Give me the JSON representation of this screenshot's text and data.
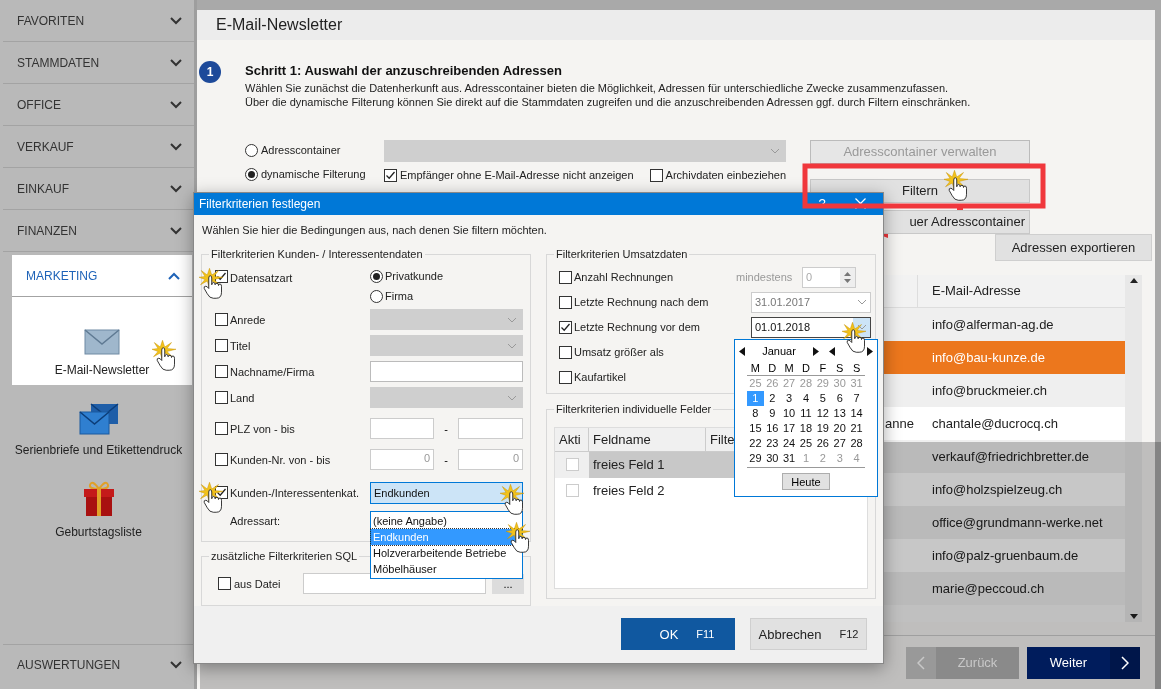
{
  "sidebar": {
    "sections": [
      {
        "label": "FAVORITEN",
        "expanded": false
      },
      {
        "label": "STAMMDATEN",
        "expanded": false
      },
      {
        "label": "OFFICE",
        "expanded": false
      },
      {
        "label": "VERKAUF",
        "expanded": false
      },
      {
        "label": "EINKAUF",
        "expanded": false
      },
      {
        "label": "FINANZEN",
        "expanded": false
      },
      {
        "label": "MARKETING",
        "expanded": true,
        "items": [
          {
            "label": "E-Mail-Newsletter",
            "kind": "envelope",
            "selected": true
          },
          {
            "label": "Serienbriefe und Etikettendruck",
            "kind": "envelopes",
            "selected": false
          },
          {
            "label": "Geburtstagsliste",
            "kind": "gift",
            "selected": false
          }
        ]
      }
    ],
    "bottom_section": {
      "label": "AUSWERTUNGEN",
      "expanded": false
    }
  },
  "page": {
    "title": "E-Mail-Newsletter",
    "step": {
      "number": "1",
      "title": "Schritt 1: Auswahl der anzuschreibenden Adressen",
      "description": [
        "Wählen Sie zunächst die Datenherkunft aus. Adresscontainer bieten die Möglichkeit, Adressen für unterschiedliche Zwecke zusammenzufassen.",
        "Über die dynamische Filterung können Sie direkt auf die Stammdaten zugreifen und die anzuschreibenden Adressen ggf. durch Filtern einschränken."
      ]
    },
    "source_options": [
      {
        "label": "Adresscontainer",
        "selected": false
      },
      {
        "label": "dynamische Filterung",
        "selected": true
      }
    ],
    "container_select": {
      "disabled": true
    },
    "options": [
      {
        "label": "Empfänger ohne E-Mail-Adresse nicht anzeigen",
        "checked": true
      },
      {
        "label": "Archivdaten einbeziehen",
        "checked": false
      }
    ],
    "buttons": [
      {
        "label": "Adresscontainer verwalten",
        "disabled": true
      },
      {
        "label": "Filtern",
        "disabled": false
      },
      {
        "label": "uer Adresscontainer",
        "disabled": false
      }
    ],
    "export_button": "Adressen exportieren",
    "table": {
      "columns": [
        "E-Mail-Adresse"
      ],
      "rows": [
        {
          "email": "info@alferman-ag.de",
          "selected": false
        },
        {
          "email": "info@bau-kunze.de",
          "selected": true
        },
        {
          "email": "info@bruckmeier.ch",
          "selected": false
        },
        {
          "column_1": "anne",
          "email": "chantale@ducrocq.ch",
          "selected": false
        },
        {
          "email": "verkauf@friedrichbretter.de",
          "selected": false
        },
        {
          "email": "info@holzspielzeug.ch",
          "selected": false
        },
        {
          "email": "office@grundmann-werke.net",
          "selected": false
        },
        {
          "email": "info@palz-gruenbaum.de",
          "selected": false
        },
        {
          "email": "marie@peccoud.ch",
          "selected": false
        }
      ]
    },
    "navigation": [
      {
        "label": "Zurück",
        "kind": "back",
        "disabled": true
      },
      {
        "label": "Weiter",
        "kind": "next",
        "disabled": false
      }
    ]
  },
  "dialog": {
    "title": "Filterkriterien festlegen",
    "help": "?",
    "instruction": "Wählen Sie hier die Bedingungen aus, nach denen Sie filtern möchten.",
    "customer_group": {
      "title": "Filterkriterien Kunden- / Interessentendaten",
      "rows": [
        {
          "kind": "radio",
          "label": "Datensatzart",
          "checked": true,
          "options": [
            {
              "label": "Privatkunde",
              "selected": true
            },
            {
              "label": "Firma",
              "selected": false
            }
          ]
        },
        {
          "kind": "select",
          "label": "Anrede",
          "checked": false
        },
        {
          "kind": "select",
          "label": "Titel",
          "checked": false
        },
        {
          "kind": "text",
          "label": "Nachname/Firma",
          "checked": false
        },
        {
          "kind": "select",
          "label": "Land",
          "checked": false
        },
        {
          "kind": "range",
          "label": "PLZ von - bis",
          "checked": false,
          "separator": "-"
        },
        {
          "kind": "range",
          "label": "Kunden-Nr. von - bis",
          "checked": false,
          "separator": "-",
          "from": "0",
          "to": "0"
        },
        {
          "kind": "dropdown",
          "label": "Kunden-/Interessentenkat.",
          "checked": true,
          "value": "Endkunden",
          "expanded": true,
          "options": [
            {
              "label": "(keine Angabe)",
              "selected": false
            },
            {
              "label": "Endkunden",
              "selected": true
            },
            {
              "label": "Holzverarbeitende Betriebe",
              "selected": false
            },
            {
              "label": "Möbelhäuser",
              "selected": false
            }
          ]
        },
        {
          "kind": "label",
          "label": "Adressart:"
        }
      ]
    },
    "sql_group": {
      "title": "zusätzliche Filterkriterien SQL",
      "label": "aus Datei",
      "checked": false,
      "browse": "..."
    },
    "sales_group": {
      "title": "Filterkriterien Umsatzdaten",
      "rows": [
        {
          "kind": "spinner",
          "label": "Anzahl Rechnungen",
          "checked": false,
          "hint": "mindestens",
          "value": "0"
        },
        {
          "kind": "date",
          "label": "Letzte Rechnung nach dem",
          "checked": false,
          "value": "31.01.2017"
        },
        {
          "kind": "date",
          "label": "Letzte Rechnung vor dem",
          "checked": true,
          "value": "01.01.2018",
          "expanded": true
        },
        {
          "kind": "plain",
          "label": "Umsatz größer als",
          "checked": false
        },
        {
          "kind": "plain",
          "label": "Kaufartikel",
          "checked": false
        }
      ]
    },
    "calendar": {
      "month": "Januar",
      "weekdays": [
        "M",
        "D",
        "M",
        "D",
        "F",
        "S",
        "S"
      ],
      "weeks": [
        [
          {
            "day": "25",
            "muted": true,
            "selected": false
          },
          {
            "day": "26",
            "muted": true,
            "selected": false
          },
          {
            "day": "27",
            "muted": true,
            "selected": false
          },
          {
            "day": "28",
            "muted": true,
            "selected": false
          },
          {
            "day": "29",
            "muted": true,
            "selected": false
          },
          {
            "day": "30",
            "muted": true,
            "selected": false
          },
          {
            "day": "31",
            "muted": true,
            "selected": false
          }
        ],
        [
          {
            "day": "1",
            "muted": false,
            "selected": true
          },
          {
            "day": "2",
            "muted": false,
            "selected": false
          },
          {
            "day": "3",
            "muted": false,
            "selected": false
          },
          {
            "day": "4",
            "muted": false,
            "selected": false
          },
          {
            "day": "5",
            "muted": false,
            "selected": false
          },
          {
            "day": "6",
            "muted": false,
            "selected": false
          },
          {
            "day": "7",
            "muted": false,
            "selected": false
          }
        ],
        [
          {
            "day": "8",
            "muted": false,
            "selected": false
          },
          {
            "day": "9",
            "muted": false,
            "selected": false
          },
          {
            "day": "10",
            "muted": false,
            "selected": false
          },
          {
            "day": "11",
            "muted": false,
            "selected": false
          },
          {
            "day": "12",
            "muted": false,
            "selected": false
          },
          {
            "day": "13",
            "muted": false,
            "selected": false
          },
          {
            "day": "14",
            "muted": false,
            "selected": false
          }
        ],
        [
          {
            "day": "15",
            "muted": false,
            "selected": false
          },
          {
            "day": "16",
            "muted": false,
            "selected": false
          },
          {
            "day": "17",
            "muted": false,
            "selected": false
          },
          {
            "day": "18",
            "muted": false,
            "selected": false
          },
          {
            "day": "19",
            "muted": false,
            "selected": false
          },
          {
            "day": "20",
            "muted": false,
            "selected": false
          },
          {
            "day": "21",
            "muted": false,
            "selected": false
          }
        ],
        [
          {
            "day": "22",
            "muted": false,
            "selected": false
          },
          {
            "day": "23",
            "muted": false,
            "selected": false
          },
          {
            "day": "24",
            "muted": false,
            "selected": false
          },
          {
            "day": "25",
            "muted": false,
            "selected": false
          },
          {
            "day": "26",
            "muted": false,
            "selected": false
          },
          {
            "day": "27",
            "muted": false,
            "selected": false
          },
          {
            "day": "28",
            "muted": false,
            "selected": false
          }
        ],
        [
          {
            "day": "29",
            "muted": false,
            "selected": false
          },
          {
            "day": "30",
            "muted": false,
            "selected": false
          },
          {
            "day": "31",
            "muted": false,
            "selected": false
          },
          {
            "day": "1",
            "muted": true,
            "selected": false
          },
          {
            "day": "2",
            "muted": true,
            "selected": false
          },
          {
            "day": "3",
            "muted": true,
            "selected": false
          },
          {
            "day": "4",
            "muted": true,
            "selected": false
          }
        ]
      ],
      "today_button": "Heute"
    },
    "fields_group": {
      "title": "Filterkriterien individuelle Felder",
      "columns": [
        "Akti",
        "Feldname",
        "Filte"
      ],
      "rows": [
        {
          "active": false,
          "name": "freies Feld 1",
          "selected": true
        },
        {
          "active": false,
          "name": "freies Feld 2",
          "selected": false
        }
      ]
    },
    "buttons": [
      {
        "label": "OK",
        "shortcut": "F11",
        "kind": "primary"
      },
      {
        "label": "Abbrechen",
        "shortcut": "F12",
        "kind": "secondary"
      }
    ]
  }
}
